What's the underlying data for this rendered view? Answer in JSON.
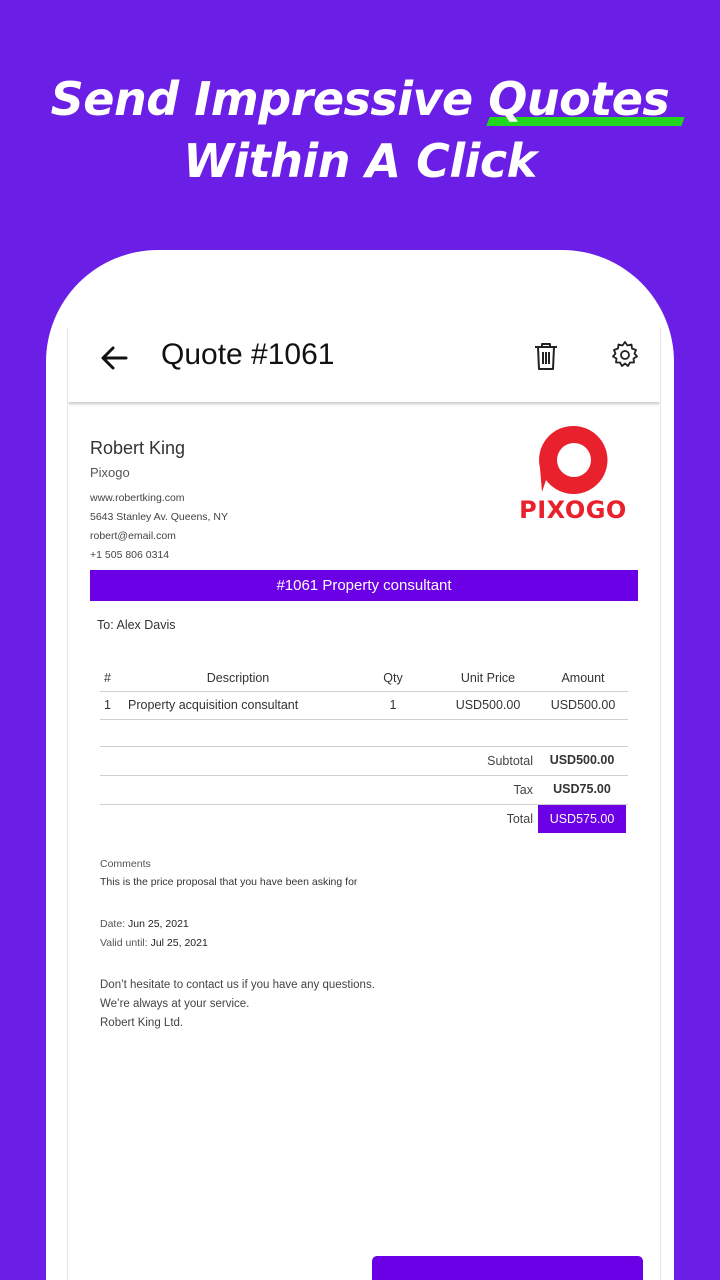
{
  "headline": {
    "line1_before": "Send Impressive ",
    "line1_highlight": "Quotes",
    "line2": "Within A Click",
    "highlight_color": "#22d61f"
  },
  "colors": {
    "background": "#6b1fe6",
    "accent": "#6b00e6",
    "logo": "#e8212c"
  },
  "appbar": {
    "title": "Quote #1061",
    "back_icon": "arrow-back-icon",
    "delete_icon": "trash-icon",
    "settings_icon": "gear-icon"
  },
  "business": {
    "name": "Robert King",
    "company": "Pixogo",
    "website": "www.robertking.com",
    "address": "5643 Stanley Av. Queens, NY",
    "email": "robert@email.com",
    "phone": "+1 505 806 0314",
    "logo_text": "PIXOGO"
  },
  "quote": {
    "banner": "#1061 Property consultant",
    "to_label": "To:",
    "to_name": "Alex Davis"
  },
  "items_table": {
    "headers": [
      "#",
      "Description",
      "Qty",
      "Unit Price",
      "Amount"
    ],
    "rows": [
      {
        "num": "1",
        "description": "Property acquisition consultant",
        "qty": "1",
        "unit_price": "USD500.00",
        "amount": "USD500.00"
      }
    ]
  },
  "totals": {
    "subtotal_label": "Subtotal",
    "subtotal": "USD500.00",
    "tax_label": "Tax",
    "tax": "USD75.00",
    "total_label": "Total",
    "total": "USD575.00"
  },
  "comments": {
    "label": "Comments",
    "text": "This is the price proposal that you have been asking for"
  },
  "dates": {
    "date_label": "Date:",
    "date": "Jun 25, 2021",
    "valid_label": "Valid until:",
    "valid": "Jul 25, 2021"
  },
  "footer": {
    "line1": "Don’t hesitate to contact us if you have any questions.",
    "line2": "We’re always at your service.",
    "line3": "Robert King Ltd."
  }
}
